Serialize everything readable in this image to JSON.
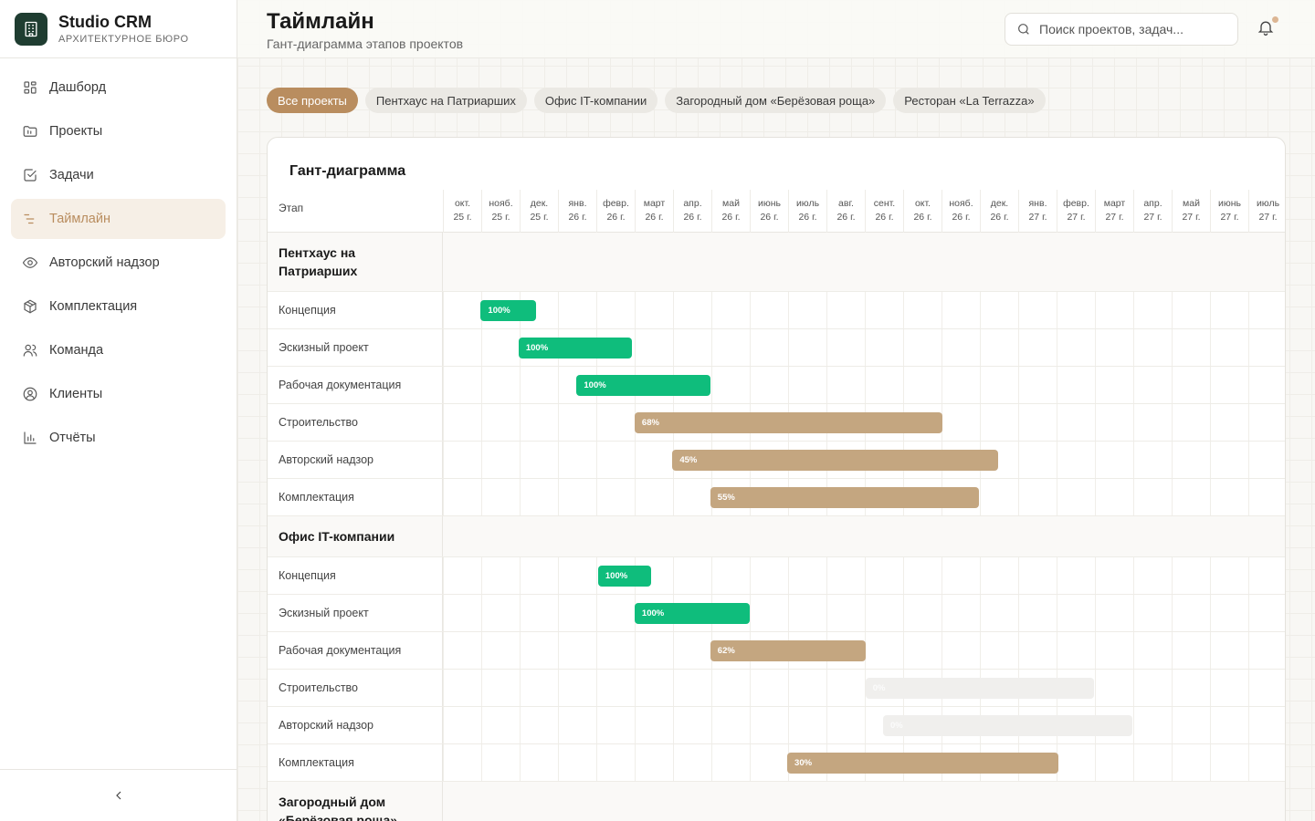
{
  "brand": {
    "name": "Studio CRM",
    "subtitle": "АРХИТЕКТУРНОЕ БЮРО"
  },
  "nav": [
    {
      "label": "Дашборд",
      "icon": "dashboard-icon"
    },
    {
      "label": "Проекты",
      "icon": "folder-icon"
    },
    {
      "label": "Задачи",
      "icon": "checkbox-icon"
    },
    {
      "label": "Таймлайн",
      "icon": "timeline-icon",
      "active": true
    },
    {
      "label": "Авторский надзор",
      "icon": "eye-icon"
    },
    {
      "label": "Комплектация",
      "icon": "package-icon"
    },
    {
      "label": "Команда",
      "icon": "users-icon"
    },
    {
      "label": "Клиенты",
      "icon": "user-circle-icon"
    },
    {
      "label": "Отчёты",
      "icon": "chart-icon"
    }
  ],
  "header": {
    "title": "Таймлайн",
    "subtitle": "Гант-диаграмма этапов проектов",
    "search_placeholder": "Поиск проектов, задач..."
  },
  "filters": [
    {
      "label": "Все проекты",
      "active": true
    },
    {
      "label": "Пентхаус на Патриарших"
    },
    {
      "label": "Офис IT-компании"
    },
    {
      "label": "Загородный дом «Берёзовая роща»"
    },
    {
      "label": "Ресторан «La Terrazza»"
    }
  ],
  "gantt": {
    "title": "Гант-диаграмма",
    "stage_header": "Этап",
    "months": [
      [
        "окт.",
        "25 г."
      ],
      [
        "нояб.",
        "25 г."
      ],
      [
        "дек.",
        "25 г."
      ],
      [
        "янв.",
        "26 г."
      ],
      [
        "февр.",
        "26 г."
      ],
      [
        "март",
        "26 г."
      ],
      [
        "апр.",
        "26 г."
      ],
      [
        "май",
        "26 г."
      ],
      [
        "июнь",
        "26 г."
      ],
      [
        "июль",
        "26 г."
      ],
      [
        "авг.",
        "26 г."
      ],
      [
        "сент.",
        "26 г."
      ],
      [
        "окт.",
        "26 г."
      ],
      [
        "нояб.",
        "26 г."
      ],
      [
        "дек.",
        "26 г."
      ],
      [
        "янв.",
        "27 г."
      ],
      [
        "февр.",
        "27 г."
      ],
      [
        "март",
        "27 г."
      ],
      [
        "апр.",
        "27 г."
      ],
      [
        "май",
        "27 г."
      ],
      [
        "июнь",
        "27 г."
      ],
      [
        "июль",
        "27 г."
      ]
    ],
    "groups": [
      {
        "name": "Пентхаус на Патриарших",
        "tasks": [
          {
            "name": "Концепция",
            "start": "2025-10-31",
            "end": "2025-12-14",
            "progress": 100
          },
          {
            "name": "Эскизный проект",
            "start": "2025-11-30",
            "end": "2026-02-28",
            "progress": 100
          },
          {
            "name": "Рабочая документация",
            "start": "2026-01-15",
            "end": "2026-05-01",
            "progress": 100
          },
          {
            "name": "Строительство",
            "start": "2026-03-02",
            "end": "2026-11-01",
            "progress": 68
          },
          {
            "name": "Авторский надзор",
            "start": "2026-04-01",
            "end": "2026-12-15",
            "progress": 45
          },
          {
            "name": "Комплектация",
            "start": "2026-05-01",
            "end": "2026-11-30",
            "progress": 55
          }
        ]
      },
      {
        "name": "Офис IT-компании",
        "tasks": [
          {
            "name": "Концепция",
            "start": "2026-02-01",
            "end": "2026-03-15",
            "progress": 100
          },
          {
            "name": "Эскизный проект",
            "start": "2026-03-02",
            "end": "2026-06-01",
            "progress": 100
          },
          {
            "name": "Рабочая документация",
            "start": "2026-05-01",
            "end": "2026-09-01",
            "progress": 62
          },
          {
            "name": "Строительство",
            "start": "2026-09-01",
            "end": "2027-03-01",
            "progress": 0
          },
          {
            "name": "Авторский надзор",
            "start": "2026-09-15",
            "end": "2027-04-01",
            "progress": 0
          },
          {
            "name": "Комплектация",
            "start": "2026-07-01",
            "end": "2027-02-01",
            "progress": 30
          }
        ]
      },
      {
        "name": "Загородный дом «Берёзовая роща»",
        "tasks": []
      }
    ]
  }
}
